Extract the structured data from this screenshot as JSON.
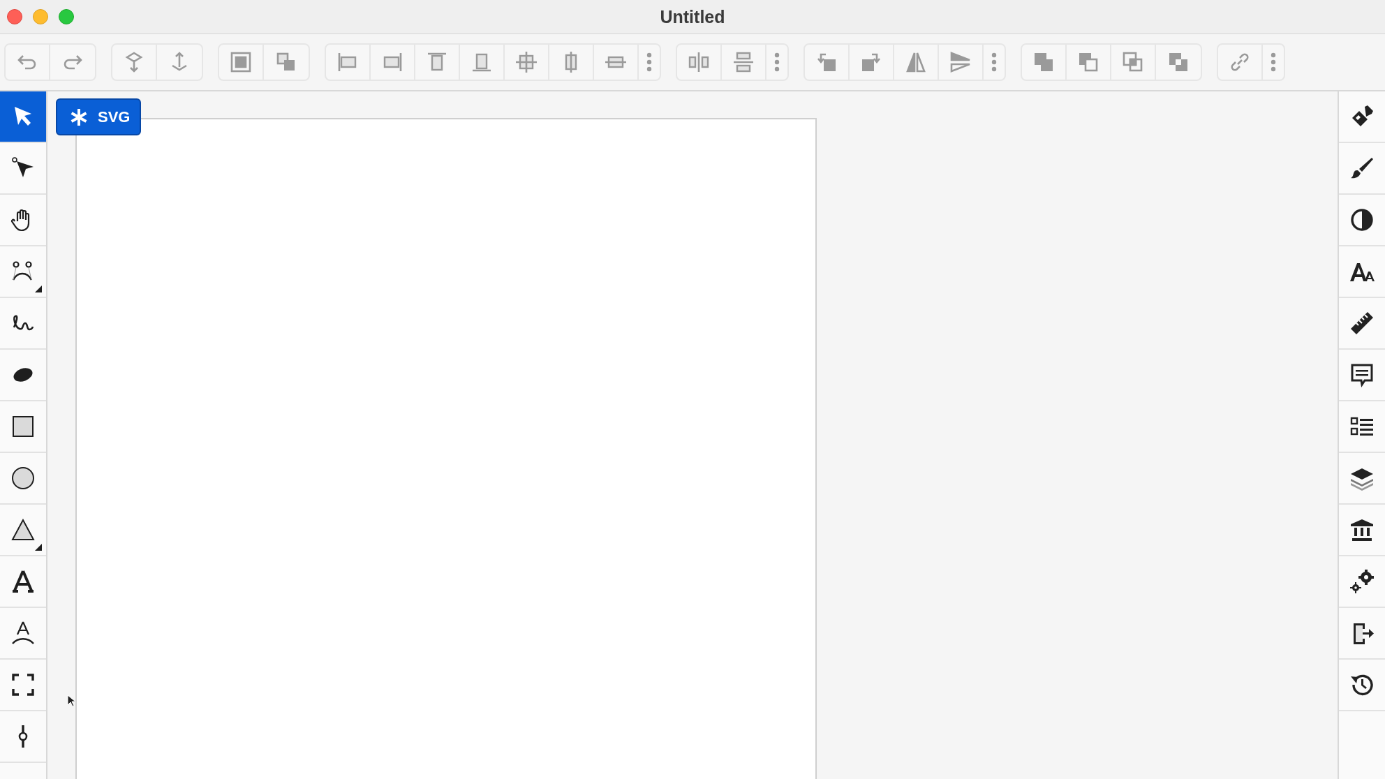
{
  "window": {
    "title": "Untitled"
  },
  "document_badge": {
    "label": "SVG"
  },
  "tools": [
    {
      "selected": true,
      "flyout": false
    },
    {
      "selected": false,
      "flyout": false
    },
    {
      "selected": false,
      "flyout": false
    },
    {
      "selected": false,
      "flyout": true
    },
    {
      "selected": false,
      "flyout": false
    },
    {
      "selected": false,
      "flyout": false
    },
    {
      "selected": false,
      "flyout": false
    },
    {
      "selected": false,
      "flyout": false
    },
    {
      "selected": false,
      "flyout": true
    },
    {
      "selected": false,
      "flyout": false
    },
    {
      "selected": false,
      "flyout": false
    },
    {
      "selected": false,
      "flyout": false
    },
    {
      "selected": false,
      "flyout": false
    }
  ]
}
